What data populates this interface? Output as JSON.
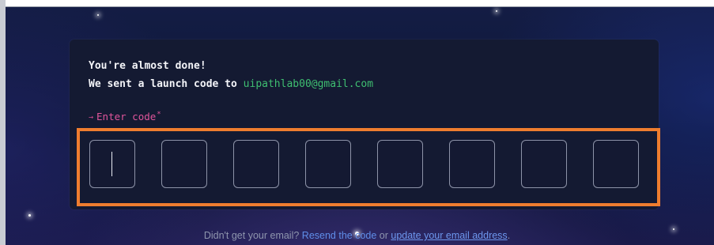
{
  "verify": {
    "heading": "You're almost done!",
    "sent_text": "We sent a launch code to ",
    "email": "uipathlab00@gmail.com",
    "enter_code_label": "Enter code",
    "arrow_icon": "→",
    "required_mark": "*",
    "code_inputs": [
      "",
      "",
      "",
      "",
      "",
      "",
      "",
      ""
    ]
  },
  "footer": {
    "prefix": "Didn't get your email? ",
    "resend_link": "Resend the code",
    "middle": " or ",
    "update_link": "update your email address",
    "suffix": "."
  },
  "colors": {
    "highlight": "#ef7d2f",
    "email": "#3fbf71",
    "enter_code": "#e0559b",
    "link": "#5f8ee9"
  }
}
